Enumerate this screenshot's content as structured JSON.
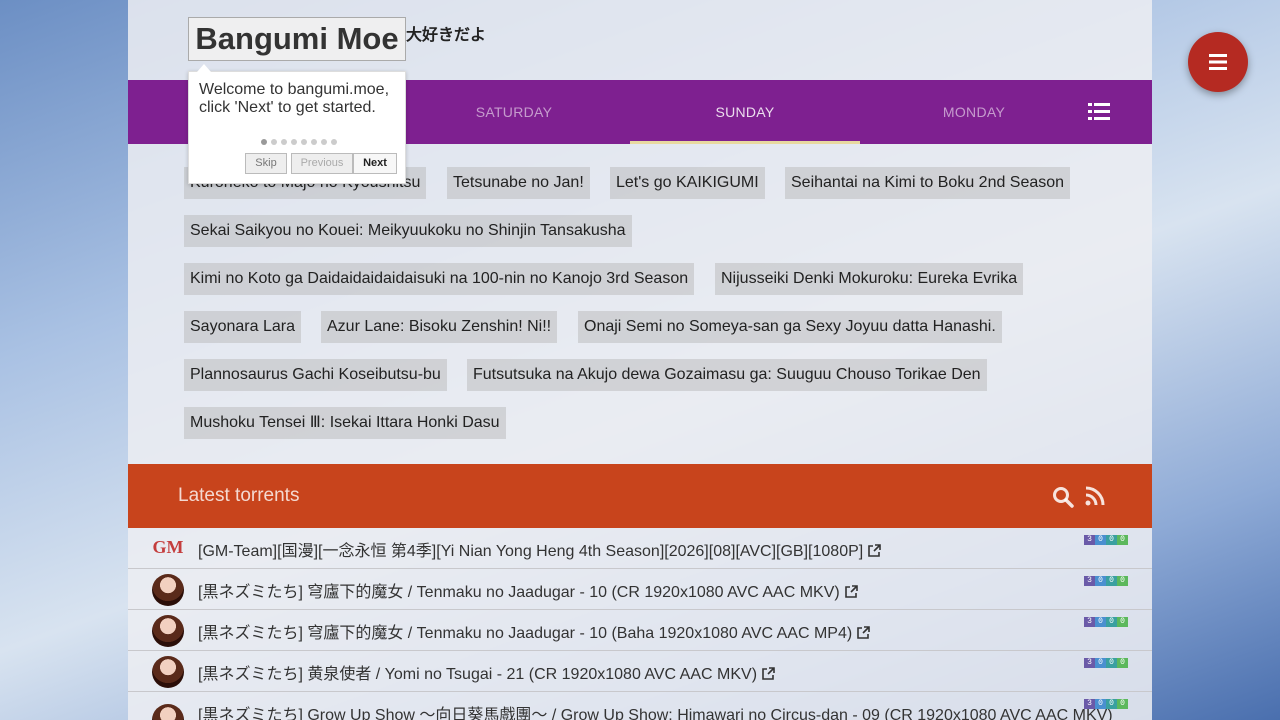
{
  "header": {
    "tagline": "大好きだよ"
  },
  "tour": {
    "title": "Bangumi Moe",
    "text": "Welcome to bangumi.moe, click 'Next' to get started.",
    "skip": "Skip",
    "previous": "Previous",
    "next": "Next",
    "steps_total": 8,
    "current_step": 1
  },
  "days": {
    "saturday": "SATURDAY",
    "sunday": "SUNDAY",
    "monday": "MONDAY",
    "active": "SUNDAY"
  },
  "tags": [
    "Kuroneko to Majo no Kyoushitsu",
    "Tetsunabe no Jan!",
    "Let's go KAIKIGUMI",
    "Seihantai na Kimi to Boku 2nd Season",
    "Sekai Saikyou no Kouei: Meikyuukoku no Shinjin Tansakusha",
    "Kimi no Koto ga Daidaidaidaidaisuki na 100-nin no Kanojo 3rd Season",
    "Nijusseiki Denki Mokuroku: Eureka Evrika",
    "Sayonara Lara",
    "Azur Lane: Bisoku Zenshin! Ni!!",
    "Onaji Semi no Someya-san ga Sexy Joyuu datta Hanashi.",
    "Plannosaurus Gachi Koseibutsu-bu",
    "Futsutsuka na Akujo dewa Gozaimasu ga: Suuguu Chouso Torikae Den",
    "Mushoku Tensei Ⅲ: Isekai Ittara Honki Dasu"
  ],
  "torrents": {
    "title": "Latest torrents",
    "items": [
      {
        "avatar": "GM",
        "title": "[GM-Team][国漫][一念永恒 第4季][Yi Nian Yong Heng 4th Season][2026][08][AVC][GB][1080P]",
        "stats": [
          "3",
          "0",
          "0",
          "0"
        ]
      },
      {
        "avatar": "",
        "title": "[黒ネズミたち] 穹廬下的魔女 / Tenmaku no Jaadugar - 10 (CR 1920x1080 AVC AAC MKV)",
        "stats": [
          "3",
          "0",
          "0",
          "0"
        ]
      },
      {
        "avatar": "",
        "title": "[黒ネズミたち] 穹廬下的魔女 / Tenmaku no Jaadugar - 10 (Baha 1920x1080 AVC AAC MP4)",
        "stats": [
          "3",
          "0",
          "0",
          "0"
        ]
      },
      {
        "avatar": "",
        "title": "[黒ネズミたち] 黄泉使者 / Yomi no Tsugai - 21 (CR 1920x1080 AVC AAC MKV)",
        "stats": [
          "3",
          "0",
          "0",
          "0"
        ]
      },
      {
        "avatar": "",
        "title": "[黒ネズミたち] Grow Up Show ～向日葵馬戲團～ / Grow Up Show: Himawari no Circus-dan - 09 (CR 1920x1080 AVC AAC MKV)",
        "stats": [
          "3",
          "0",
          "0",
          "0"
        ]
      }
    ]
  },
  "colors": {
    "daybar": "#7e2090",
    "torrent_header": "#c8441c",
    "fab": "#b52a22",
    "stat_colors": [
      "#6a5aa8",
      "#4a8fd0",
      "#3aa0a0",
      "#5cb85c"
    ]
  },
  "icons": {
    "day_list": "list-icon",
    "search": "search-icon",
    "rss": "rss-icon",
    "external": "external-link-icon",
    "fab": "menu-icon"
  }
}
